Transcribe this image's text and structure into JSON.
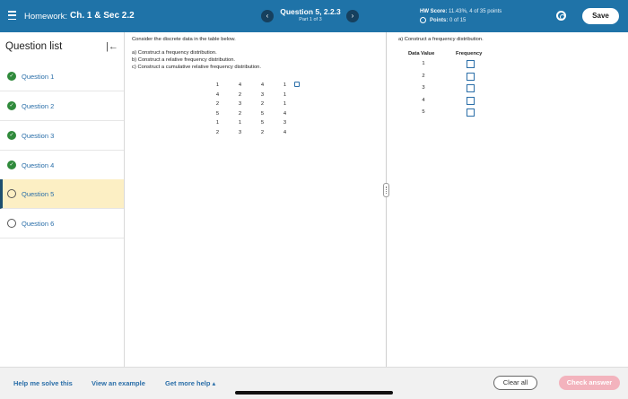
{
  "header": {
    "hw_prefix": "Homework:",
    "hw_title": "Ch. 1 & Sec 2.2",
    "question_title": "Question 5, 2.2.3",
    "question_part": "Part 1 of 3",
    "prev_icon": "chevron-left-icon",
    "next_icon": "chevron-right-icon",
    "prev_glyph": "‹",
    "next_glyph": "›",
    "score_label": "HW Score:",
    "score_value": "11.43%, 4 of 35 points",
    "points_label": "Points:",
    "points_value": "0 of 15",
    "save_label": "Save",
    "colors": {
      "header_bg": "#1f73a8",
      "nav_btn": "#16405e"
    }
  },
  "sidebar": {
    "title": "Question list",
    "collapse_glyph": "|←",
    "items": [
      {
        "label": "Question 1",
        "status": "complete"
      },
      {
        "label": "Question 2",
        "status": "complete"
      },
      {
        "label": "Question 3",
        "status": "complete"
      },
      {
        "label": "Question 4",
        "status": "complete"
      },
      {
        "label": "Question 5",
        "status": "current"
      },
      {
        "label": "Question 6",
        "status": "open"
      }
    ],
    "check_glyph": "✓",
    "colors": {
      "complete": "#2f8a3b",
      "active_bg": "#fcefc4"
    }
  },
  "question": {
    "prompt": "Consider the discrete data in the table below.",
    "parts": [
      "a) Construct a frequency distribution.",
      "b) Construct a relative frequency distribution.",
      "c) Construct a cumulative relative frequency distribution."
    ],
    "table": [
      [
        "1",
        "4",
        "4",
        "1"
      ],
      [
        "4",
        "2",
        "3",
        "1"
      ],
      [
        "2",
        "3",
        "2",
        "1"
      ],
      [
        "5",
        "2",
        "5",
        "4"
      ],
      [
        "1",
        "1",
        "5",
        "3"
      ],
      [
        "2",
        "3",
        "2",
        "4"
      ]
    ]
  },
  "answer": {
    "title": "a) Construct a frequency distribution.",
    "col_value": "Data Value",
    "col_frequency": "Frequency",
    "rows": [
      {
        "value": "1",
        "frequency": ""
      },
      {
        "value": "2",
        "frequency": ""
      },
      {
        "value": "3",
        "frequency": ""
      },
      {
        "value": "4",
        "frequency": ""
      },
      {
        "value": "5",
        "frequency": ""
      }
    ]
  },
  "footer": {
    "help_label": "Help me solve this",
    "example_label": "View an example",
    "more_help_label": "Get more help ▴",
    "clear_label": "Clear all",
    "check_label": "Check answer",
    "colors": {
      "check_btn": "#f3b3bd",
      "link": "#2a6ea8"
    }
  }
}
